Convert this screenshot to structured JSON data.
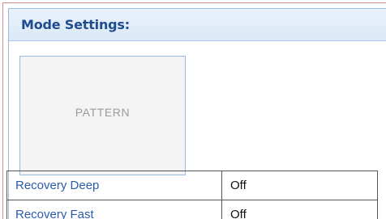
{
  "panel": {
    "title": "Mode Settings:"
  },
  "pattern": {
    "label": "PATTERN"
  },
  "settings": [
    {
      "name": "Recovery Deep",
      "value": "Off"
    },
    {
      "name": "Recovery Fast",
      "value": "Off"
    }
  ],
  "colors": {
    "header_text": "#1f4c8f",
    "header_bg": "#dbe8f6",
    "link_text": "#2a5caa",
    "border_blue": "#9bbbe0",
    "outer_border": "#d08a8a"
  }
}
